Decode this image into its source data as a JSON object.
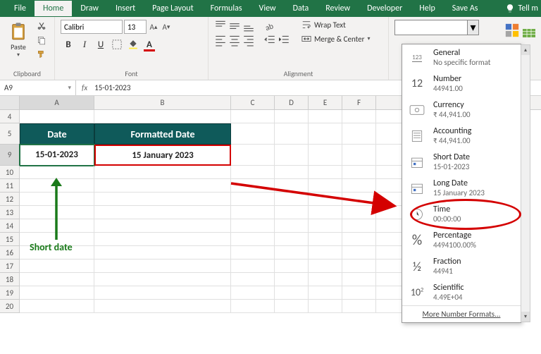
{
  "tabs": {
    "file": "File",
    "home": "Home",
    "draw": "Draw",
    "insert": "Insert",
    "page_layout": "Page Layout",
    "formulas": "Formulas",
    "view": "View",
    "data": "Data",
    "review": "Review",
    "developer": "Developer",
    "help": "Help",
    "save_as": "Save As",
    "tell_me": "Tell m"
  },
  "ribbon": {
    "clipboard": {
      "paste": "Paste",
      "label": "Clipboard"
    },
    "font": {
      "name": "Calibri",
      "size": "13",
      "label": "Font",
      "bold": "B",
      "italic": "I",
      "underline": "U"
    },
    "alignment": {
      "wrap": "Wrap Text",
      "merge": "Merge & Center",
      "label": "Alignment"
    }
  },
  "name_box": "A9",
  "formula_value": "15-01-2023",
  "columns": {
    "A": "A",
    "B": "B",
    "C": "C",
    "D": "D",
    "E": "E",
    "F": "F"
  },
  "rows": [
    "4",
    "5",
    "9",
    "10",
    "11",
    "12",
    "13",
    "14",
    "15",
    "16",
    "17",
    "18",
    "19",
    "20"
  ],
  "headers": {
    "date": "Date",
    "formatted": "Formatted Date"
  },
  "cells": {
    "a9": "15-01-2023",
    "b9": "15 January 2023"
  },
  "annotation": {
    "short_date": "Short date"
  },
  "formats": {
    "general": {
      "title": "General",
      "sample": "No specific format"
    },
    "number": {
      "title": "Number",
      "sample": "44941.00"
    },
    "currency": {
      "title": "Currency",
      "sample": "₹ 44,941.00"
    },
    "accounting": {
      "title": "Accounting",
      "sample": "₹ 44,941.00"
    },
    "short_date": {
      "title": "Short Date",
      "sample": "15-01-2023"
    },
    "long_date": {
      "title": "Long Date",
      "sample": "15 January 2023"
    },
    "time": {
      "title": "Time",
      "sample": "00:00:00"
    },
    "percentage": {
      "title": "Percentage",
      "sample": "4494100.00%"
    },
    "fraction": {
      "title": "Fraction",
      "sample": "44941"
    },
    "scientific": {
      "title": "Scientific",
      "sample": "4.49E+04"
    },
    "more": "More Number Formats..."
  }
}
